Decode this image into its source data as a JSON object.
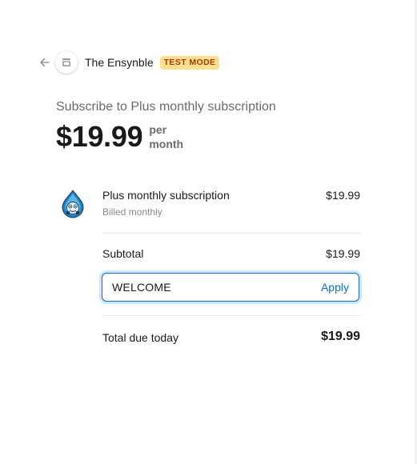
{
  "header": {
    "business_name": "The Ensynble",
    "mode_badge": "TEST MODE",
    "badge_bg": "#ffde92",
    "badge_text_color": "#a33d00",
    "back_icon": "arrow-left-icon",
    "logo_icon": "store-icon"
  },
  "summary": {
    "title": "Subscribe to Plus monthly subscription",
    "price": "$19.99",
    "period_line1": "per",
    "period_line2": "month"
  },
  "line_item": {
    "icon": "droplet-mascot-icon",
    "name": "Plus monthly subscription",
    "billing": "Billed monthly",
    "price": "$19.99"
  },
  "subtotal": {
    "label": "Subtotal",
    "value": "$19.99"
  },
  "promo": {
    "code": "WELCOME",
    "apply_label": "Apply",
    "accent": "#0570de"
  },
  "total": {
    "label": "Total due today",
    "value": "$19.99"
  }
}
